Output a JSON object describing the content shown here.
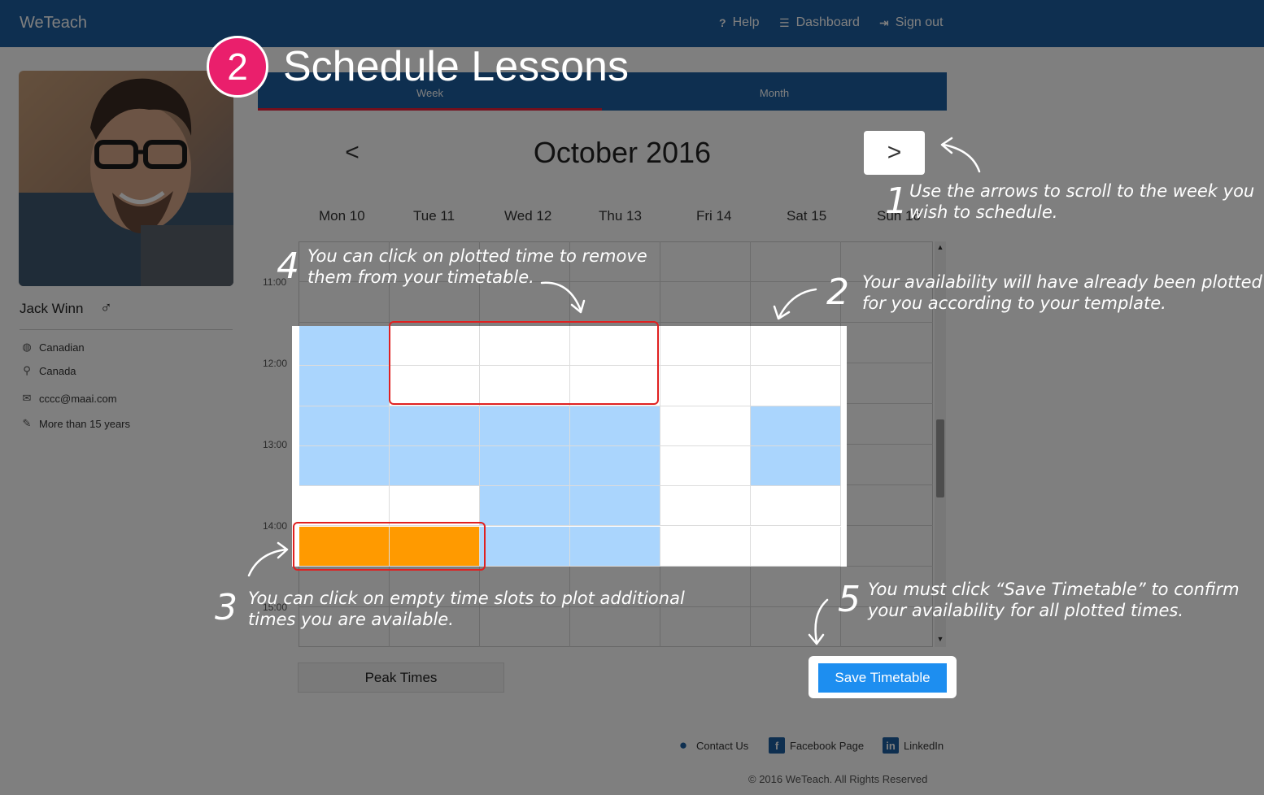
{
  "navbar": {
    "brand": "WeTeach",
    "help": "Help",
    "dashboard": "Dashboard",
    "sign_out": "Sign out",
    "icons": [
      "question-icon",
      "list-icon",
      "sign-out-icon"
    ]
  },
  "profile": {
    "name": "Jack Winn",
    "gender_symbol": "♂",
    "nationality": "Canadian",
    "country": "Canada",
    "email": "cccc@maai.com",
    "experience": "More than 15 years",
    "icons": [
      "globe-icon",
      "location-pin-icon",
      "envelope-icon",
      "pencil-icon"
    ]
  },
  "tabs": [
    "Week",
    "Month"
  ],
  "active_tab": "Week",
  "calendar": {
    "title": "October 2016",
    "prev_symbol": "<",
    "next_symbol": ">",
    "days": [
      "Mon 10",
      "Tue 11",
      "Wed 12",
      "Thu 13",
      "Fri 14",
      "Sat 15",
      "Sun 16"
    ],
    "times": [
      "11:00",
      "12:00",
      "13:00",
      "14:00",
      "15:00"
    ],
    "slot_states_legend": {
      "a": "available (plotted)",
      "o": "newly plotted (selected)",
      "e": "empty"
    },
    "visible_slots": [
      [
        "a",
        "e",
        "e",
        "e",
        "e",
        "e"
      ],
      [
        "a",
        "e",
        "e",
        "e",
        "e",
        "e"
      ],
      [
        "a",
        "a",
        "a",
        "a",
        "e",
        "a"
      ],
      [
        "a",
        "a",
        "a",
        "a",
        "e",
        "a"
      ],
      [
        "e",
        "e",
        "a",
        "a",
        "e",
        "e"
      ],
      [
        "o",
        "o",
        "a",
        "a",
        "e",
        "e"
      ]
    ]
  },
  "buttons": {
    "peak_times": "Peak Times",
    "save_timetable": "Save Timetable"
  },
  "footer": {
    "contact": "Contact Us",
    "facebook": "Facebook Page",
    "linkedin": "LinkedIn",
    "copyright": "© 2016 WeTeach. All Rights Reserved"
  },
  "tutorial": {
    "step_number": "2",
    "step_title": "Schedule Lessons",
    "notes": [
      {
        "num": "1",
        "line1": "Use the arrows to scroll to the week you",
        "line2": "wish to schedule."
      },
      {
        "num": "2",
        "line1": "Your availability will have already been plotted",
        "line2": "for you according to your template."
      },
      {
        "num": "3",
        "line1": "You can click on empty time slots to plot additional",
        "line2": "times you are available."
      },
      {
        "num": "4",
        "line1": "You can click on plotted time to remove",
        "line2": "them from your timetable."
      },
      {
        "num": "5",
        "line1": "You must click “Save Timetable”  to confirm",
        "line2": "your availability for all plotted times."
      }
    ]
  },
  "colors": {
    "brand_blue": "#1d5fa0",
    "available_blue": "#aad5fd",
    "selected_orange": "#ff9a00",
    "highlight_red": "#e02020",
    "badge_pink": "#ea1f6c",
    "save_button_blue": "#1d8ef0"
  }
}
